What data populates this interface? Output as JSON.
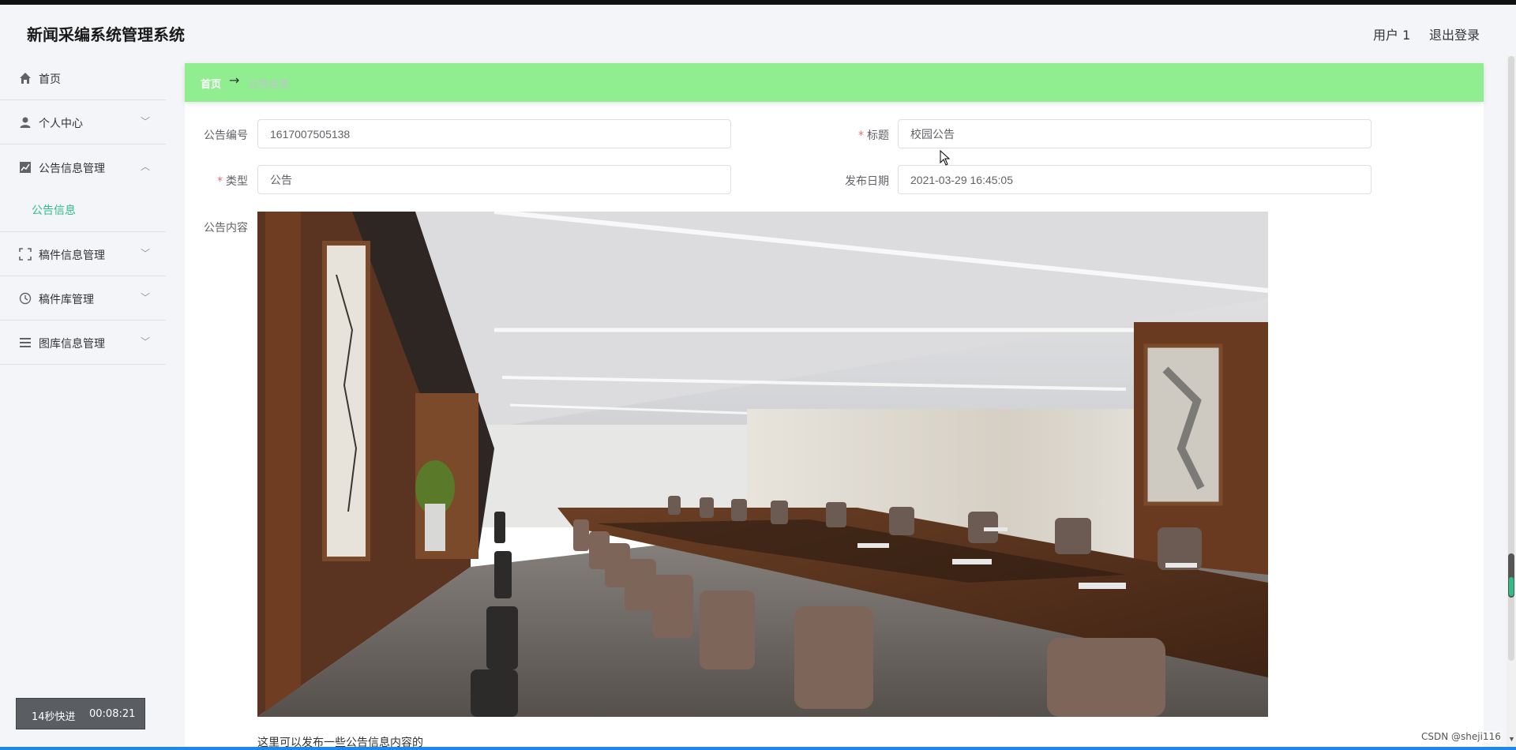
{
  "header": {
    "app_title": "新闻采编系统管理系统",
    "user_label": "用户 1",
    "logout_label": "退出登录"
  },
  "sidebar": {
    "items": [
      {
        "label": "首页",
        "icon": "home-icon"
      },
      {
        "label": "个人中心",
        "icon": "user-icon"
      },
      {
        "label": "公告信息管理",
        "icon": "chart-icon",
        "expanded": true
      },
      {
        "label": "稿件信息管理",
        "icon": "scan-icon"
      },
      {
        "label": "稿件库管理",
        "icon": "clock-icon"
      },
      {
        "label": "图库信息管理",
        "icon": "list-icon"
      }
    ],
    "subitems": [
      {
        "label": "公告信息"
      }
    ],
    "active_color": "#2fbd86"
  },
  "timer": {
    "speed_label": "14秒快进",
    "time": "00:08:21"
  },
  "breadcrumb": {
    "home": "首页",
    "arrow": "→",
    "current": "公告信息",
    "bg_color": "#90ee90"
  },
  "form": {
    "notice_no": {
      "label": "公告编号",
      "value": "1617007505138"
    },
    "title": {
      "label": "标题",
      "value": "校园公告",
      "required": true
    },
    "type": {
      "label": "类型",
      "value": "公告",
      "required": true
    },
    "publish_date": {
      "label": "发布日期",
      "value": "2021-03-29 16:45:05"
    },
    "content": {
      "label": "公告内容",
      "text": "这里可以发布一些公告信息内容的"
    }
  },
  "watermark": "CSDN @sheji116"
}
